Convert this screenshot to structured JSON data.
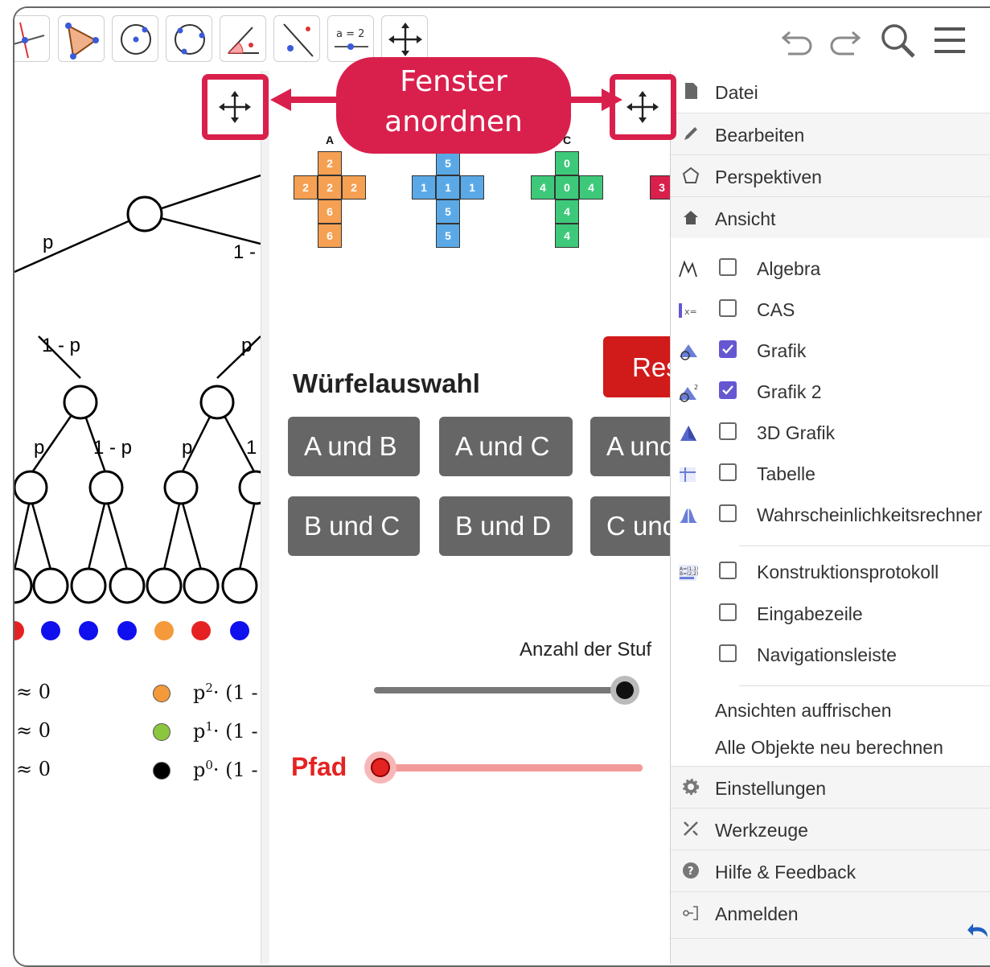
{
  "toolbar": {
    "tools": [
      "line-tool-icon",
      "polygon-tool-icon",
      "circle-center-tool-icon",
      "circle-three-points-tool-icon",
      "angle-tool-icon",
      "reflect-tool-icon",
      "slider-tool-icon",
      "move-graphics-view-tool-icon"
    ],
    "slider_label": "a = 2",
    "right_icons": [
      "undo-icon",
      "redo-icon",
      "search-icon",
      "hamburger-menu-icon"
    ]
  },
  "callout": {
    "line1": "Fenster",
    "line2": "anordnen",
    "color": "#d9204c"
  },
  "dice": [
    {
      "label": "A",
      "color": "#f5a052",
      "top": "2",
      "middle": [
        "2",
        "2",
        "2"
      ],
      "bottom": [
        "6",
        "6"
      ]
    },
    {
      "label": "",
      "color": "#5aa9e6",
      "top": "5",
      "middle": [
        "1",
        "1",
        "1"
      ],
      "bottom": [
        "5",
        "5"
      ]
    },
    {
      "label": "C",
      "color": "#3ec97a",
      "top": "0",
      "middle": [
        "4",
        "0",
        "4"
      ],
      "bottom": [
        "4",
        "4"
      ]
    },
    {
      "label": "",
      "color": "#d9204c",
      "top": "",
      "middle": [
        "3"
      ],
      "bottom": []
    }
  ],
  "mid": {
    "heading": "Würfelauswahl",
    "reset_label": "Res",
    "buttons": [
      "A und B",
      "A und C",
      "A und",
      "B und C",
      "B und D",
      "C und"
    ],
    "stufen_label": "Anzahl der Stuf",
    "pfad_label": "Pfad"
  },
  "tree": {
    "edge_labels": [
      "p",
      "1 -",
      "1 - p",
      "p",
      "p",
      "1 - p",
      "p",
      "1"
    ],
    "leaf_dot_colors": [
      "#e52222",
      "#1010ee",
      "#1010ee",
      "#1010ee",
      "#f49a3a",
      "#e52222",
      "#1010ee",
      "#1010ee"
    ],
    "approx": [
      "≈ 0",
      "≈ 0",
      "≈ 0"
    ],
    "legend": [
      {
        "color": "#f49a3a",
        "exp": "2",
        "text": "p"
      },
      {
        "color": "#8cc63f",
        "exp": "1",
        "text": "p"
      },
      {
        "color": "#000000",
        "exp": "0",
        "text": "p"
      }
    ],
    "legend_tail": "· (1 -"
  },
  "menu": {
    "top_items": [
      {
        "label": "Datei",
        "icon": "file-icon"
      },
      {
        "label": "Bearbeiten",
        "icon": "pencil-icon"
      },
      {
        "label": "Perspektiven",
        "icon": "pentagon-icon"
      },
      {
        "label": "Ansicht",
        "icon": "home-icon"
      }
    ],
    "views": [
      {
        "label": "Algebra",
        "checked": false,
        "icon": "algebra-view-icon"
      },
      {
        "label": "CAS",
        "checked": false,
        "icon": "cas-view-icon"
      },
      {
        "label": "Grafik",
        "checked": true,
        "icon": "graphics-view-icon"
      },
      {
        "label": "Grafik 2",
        "checked": true,
        "icon": "graphics2-view-icon"
      },
      {
        "label": "3D Grafik",
        "checked": false,
        "icon": "3d-graphics-view-icon"
      },
      {
        "label": "Tabelle",
        "checked": false,
        "icon": "spreadsheet-view-icon"
      },
      {
        "label": "Wahrscheinlichkeitsrechner",
        "checked": false,
        "icon": "probability-view-icon"
      },
      {
        "label": "Konstruktionsprotokoll",
        "checked": false,
        "icon": "construction-protocol-icon"
      },
      {
        "label": "Eingabezeile",
        "checked": false,
        "icon": ""
      },
      {
        "label": "Navigationsleiste",
        "checked": false,
        "icon": ""
      }
    ],
    "actions": [
      "Ansichten auffrischen",
      "Alle Objekte neu berechnen"
    ],
    "bottom_items": [
      {
        "label": "Einstellungen",
        "icon": "gear-icon"
      },
      {
        "label": "Werkzeuge",
        "icon": "tools-icon"
      },
      {
        "label": "Hilfe & Feedback",
        "icon": "help-icon"
      },
      {
        "label": "Anmelden",
        "icon": "sign-in-icon"
      }
    ]
  }
}
